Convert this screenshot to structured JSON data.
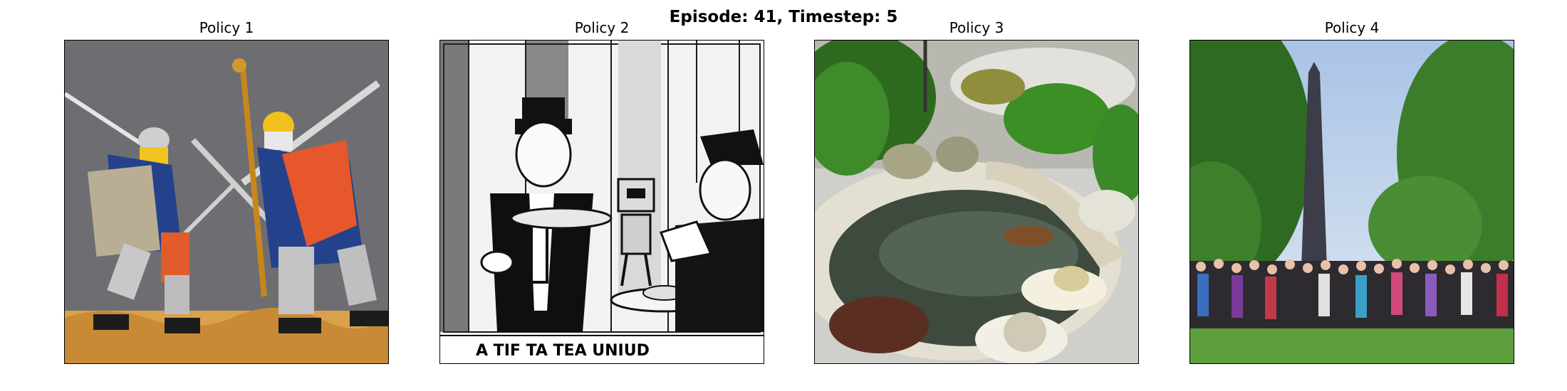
{
  "figure": {
    "suptitle": "Episode: 41, Timestep: 5",
    "panels": [
      {
        "title": "Policy 1",
        "image": "knights-fighting-paper-craft"
      },
      {
        "title": "Policy 2",
        "image": "comic-waiter-robot-illustration",
        "caption_text": "A TIF TA TEA UNIUD"
      },
      {
        "title": "Policy 3",
        "image": "zen-garden-pond"
      },
      {
        "title": "Policy 4",
        "image": "crowd-by-obelisk-monument"
      }
    ]
  }
}
